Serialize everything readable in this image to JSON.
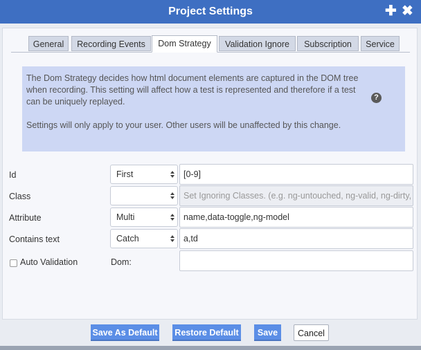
{
  "window": {
    "title": "Project Settings",
    "plus_glyph": "✚",
    "close_glyph": "✖"
  },
  "tabs": [
    {
      "label": "General"
    },
    {
      "label": "Recording Events"
    },
    {
      "label": "Dom Strategy",
      "active": true
    },
    {
      "label": "Validation Ignore"
    },
    {
      "label": "Subscription"
    },
    {
      "label": "Service"
    }
  ],
  "info": {
    "paragraph1": "The Dom Strategy decides how html document elements are captured in the DOM tree when recording. This setting will affect how a test is represented and therefore if a test can be uniquely replayed.",
    "paragraph2": "Settings will only apply to your user. Other users will be unaffected by this change.",
    "help_glyph": "?"
  },
  "form": {
    "id": {
      "label": "Id",
      "select": "First",
      "value": "[0-9]"
    },
    "class": {
      "label": "Class",
      "select": "",
      "placeholder": "Set Ignoring Classes. (e.g. ng-untouched, ng-valid, ng-dirty,"
    },
    "attribute": {
      "label": "Attribute",
      "select": "Multi",
      "value": "name,data-toggle,ng-model"
    },
    "contains_text": {
      "label": "Contains text",
      "select": "Catch",
      "value": "a,td"
    },
    "auto_validation": {
      "label": "Auto Validation",
      "checked": false
    },
    "dom": {
      "label": "Dom:",
      "value": ""
    }
  },
  "buttons": {
    "save_default": "Save As Default",
    "restore_default": "Restore Default",
    "save": "Save",
    "cancel": "Cancel"
  }
}
